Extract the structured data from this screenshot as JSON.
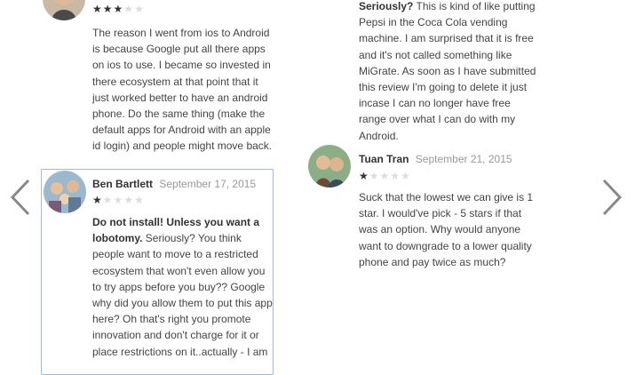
{
  "reviews": [
    {
      "author": "",
      "date": "",
      "rating": 3,
      "title": "",
      "text": "The reason I went from ios to Android is because Google put all there apps on ios to use. I became so invested in there ecosystem at that point that it just worked better to have an android phone. Do the same thing (make the default apps for Android with an apple id login) and people might move back."
    },
    {
      "author": "Ben Bartlett",
      "date": "September 17, 2015",
      "rating": 1,
      "title": "Do not install! Unless you want a lobotomy.",
      "text": "Seriously? You think people want to move to a restricted ecosystem that won't even allow you to try apps before you buy?? Google why did you allow them to put this app here? Oh that's right you promote innovation and don't charge for it or place restrictions on it..actually - I am"
    },
    {
      "author": "",
      "date": "",
      "rating": 0,
      "title": "Seriously?",
      "text": "This is kind of like putting Pepsi in the Coca Cola vending machine. I am surprised that it is free and it's not called something like MiGrate. As soon as I have submitted this review I'm going to delete it just incase I can no longer have free range over what I can do with my Android."
    },
    {
      "author": "Tuan Tran",
      "date": "September 21, 2015",
      "rating": 1,
      "title": "",
      "text": "Suck that the lowest we can give is 1 star. I would've pick - 5 stars if that was an option. Why would anyone want to downgrade to a lower quality phone and pay twice as much?"
    }
  ],
  "colors": {
    "star_filled": "#333333",
    "star_empty": "#dddddd",
    "card_border": "#9ab8e8",
    "date": "#999999"
  },
  "icons": {
    "prev": "chevron-left-icon",
    "next": "chevron-right-icon",
    "star": "star-icon"
  }
}
